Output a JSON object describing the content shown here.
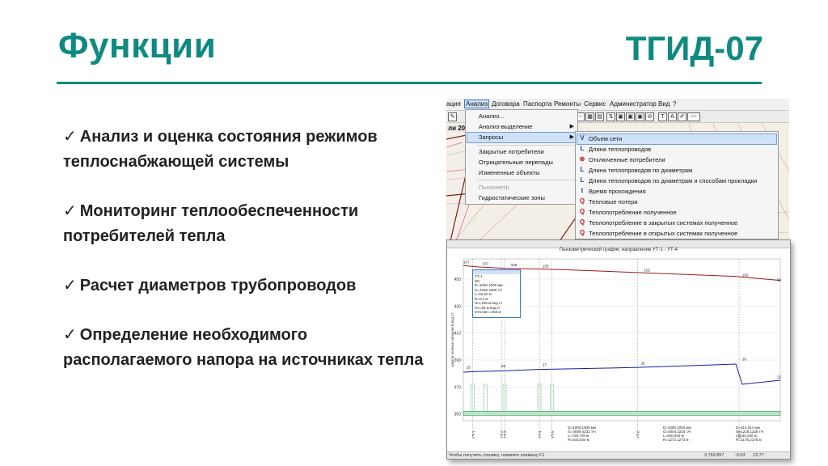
{
  "slide": {
    "title": "Функции",
    "brand": "ТГИД-07",
    "bullets": [
      "Анализ и оценка состояния режимов теплоснабжающей системы",
      "Мониторинг теплообеспеченности потребителей тепла",
      "Расчет диаметров трубопроводов",
      "Определение необходимого располагаемого напора на источниках тепла"
    ],
    "check_mark": "✓"
  },
  "app": {
    "menubar": [
      "ация",
      "Анализ",
      "Договора",
      "Паспорта",
      "Ремонты",
      "Сервис",
      "Администратор",
      "Вид",
      "?"
    ],
    "map_date": "ли 201",
    "analysis_menu": {
      "items": [
        "Анализ...",
        "Анализ-выделение",
        "Запросы",
        "Закрытые потребители",
        "Отрицательные перепады",
        "Измененные объекты",
        "Пьезометр",
        "Гидростатические зоны"
      ]
    },
    "queries_menu": {
      "items": [
        {
          "icon": "V",
          "label": "Объем сети"
        },
        {
          "icon": "L",
          "label": "Длина теплопроводов"
        },
        {
          "icon": "⊗",
          "label": "Отключенные потребители"
        },
        {
          "icon": "L",
          "label": "Длина теплопроводов по диаметрам"
        },
        {
          "icon": "L",
          "label": "Длина теплопроводов по диаметрам и способам прокладки"
        },
        {
          "icon": "t",
          "label": "Время прохождения"
        },
        {
          "icon": "Q",
          "label": "Тепловые потери"
        },
        {
          "icon": "Q",
          "label": "Теплопотребление полученное"
        },
        {
          "icon": "Q",
          "label": "Теплопотребление в закрытых системах полученное"
        },
        {
          "icon": "Q",
          "label": "Теплопотребление в открытых системах полученное"
        }
      ]
    }
  },
  "graph": {
    "title": "Пьезометрический график, направление УТ-1 - УТ-4",
    "ylabel": "Шкала полных напоров в вод.ст",
    "yticks": [
      "450",
      "430",
      "410",
      "390",
      "370",
      "350"
    ],
    "supply_line": {
      "x": [
        0,
        0.05,
        0.13,
        0.24,
        0.32,
        0.86,
        0.88,
        1.0
      ],
      "y": [
        460,
        459,
        458,
        457.5,
        457,
        452,
        451.5,
        449
      ]
    },
    "return_line": {
      "x": [
        0,
        0.05,
        0.13,
        0.24,
        0.55,
        0.86,
        0.88,
        1.0
      ],
      "y": [
        381,
        381.5,
        382,
        383,
        384.5,
        387,
        372,
        375
      ]
    },
    "point_labels": [
      "107",
      "107",
      "106",
      "105",
      "102",
      "102",
      "96",
      "25",
      "26",
      "27",
      "32",
      "35",
      "22"
    ],
    "nodes": [
      "УТ-1",
      "УТ-2",
      "УТ-3",
      "УТ-4",
      "УТ-5",
      "УТ-6",
      "УТ-7"
    ],
    "info_box": [
      "УТ-1",
      "М1",
      "D=1000,1000 мм",
      "G=4180.4300 т/ч",
      "L=32,32 м",
      "R=0,0 м",
      "Нп=106 м вод.ст",
      "Но=26 м вод.ст",
      "Отн.нап.=355 м"
    ],
    "segments": [
      [
        "D=1000,1000 мм",
        "G=4009,4231 т/ч",
        "L=729,729 м",
        "R=544,544 м"
      ],
      [
        "D=1000,1000 мм",
        "G=4004,4225 т/ч",
        "L=840,840 м",
        "R=1272,1273 м"
      ],
      [
        "D=514,514 мм",
        "G=1218,1226 т/ч",
        "L=240,240 м",
        "R=2175,2175 м"
      ]
    ],
    "status": [
      "Чтобы получить справку, нажмите клавишу F1",
      "3,769.857",
      "-0.03",
      "13.77"
    ]
  },
  "colors": {
    "accent": "#0f8a80",
    "supply": "#a01818",
    "return": "#1a1aa0",
    "ground": "#1e9e48"
  }
}
